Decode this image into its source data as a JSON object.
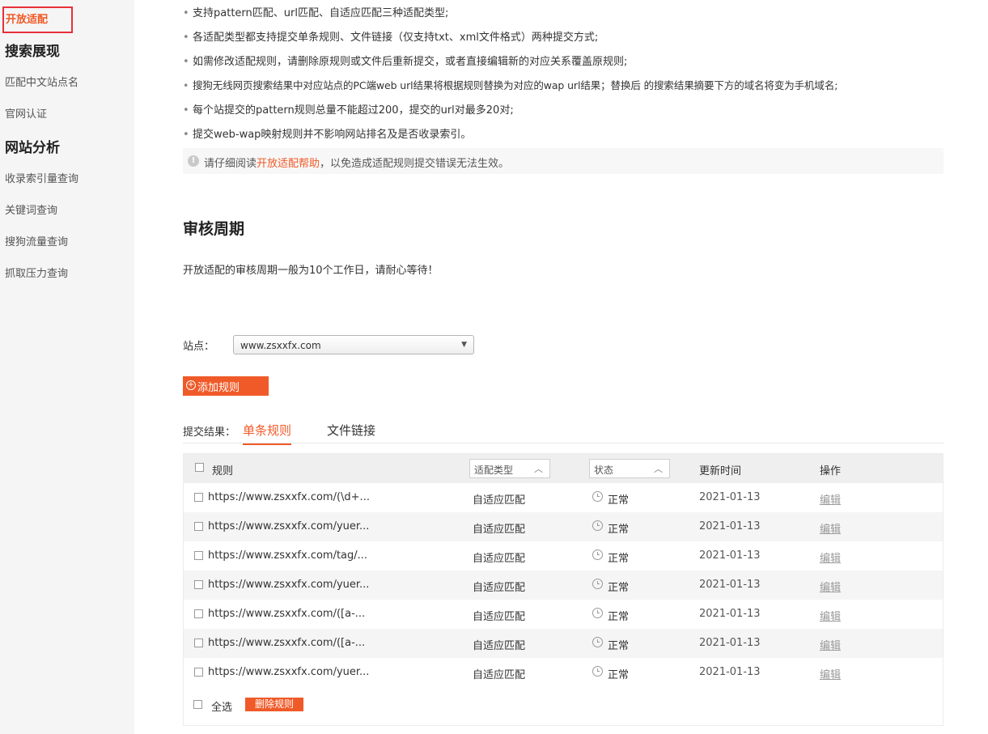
{
  "sidebar": {
    "active_item": "开放适配",
    "groups": [
      {
        "heading": "搜索展现",
        "items": [
          "匹配中文站点名",
          "官网认证"
        ]
      },
      {
        "heading": "网站分析",
        "items": [
          "收录索引量查询",
          "关键词查询",
          "搜狗流量查询",
          "抓取压力查询"
        ]
      }
    ]
  },
  "notes": {
    "bullets": [
      "支持pattern匹配、url匹配、自适应匹配三种适配类型;",
      "各适配类型都支持提交单条规则、文件链接（仅支持txt、xml文件格式）两种提交方式;",
      "如需修改适配规则，请删除原规则或文件后重新提交，或者直接编辑新的对应关系覆盖原规则;",
      "搜狗无线网页搜索结果中对应站点的PC端web url结果将根据规则替换为对应的wap url结果；替换后 的搜索结果摘要下方的域名将变为手机域名;",
      "每个站提交的pattern规则总量不能超过200，提交的url对最多20对;",
      "提交web-wap映射规则并不影响网站排名及是否收录索引。"
    ],
    "notice_prefix": "请仔细阅读",
    "notice_link": "开放适配帮助",
    "notice_suffix": "，以免造成适配规则提交错误无法生效。"
  },
  "review": {
    "title": "审核周期",
    "desc": "开放适配的审核周期一般为10个工作日，请耐心等待！"
  },
  "site": {
    "label": "站点：",
    "value": "www.zsxxfx.com"
  },
  "add_button": "添加规则",
  "tabs": {
    "label": "提交结果：",
    "items": [
      "单条规则",
      "文件链接"
    ]
  },
  "table": {
    "headers": {
      "rule": "规则",
      "type": "适配类型",
      "status": "状态",
      "updated": "更新时间",
      "action": "操作"
    },
    "rows": [
      {
        "rule": "https://www.zsxxfx.com/(\\d+...",
        "type": "自适应匹配",
        "status": "正常",
        "updated": "2021-01-13",
        "action": "编辑"
      },
      {
        "rule": "https://www.zsxxfx.com/yuer...",
        "type": "自适应匹配",
        "status": "正常",
        "updated": "2021-01-13",
        "action": "编辑"
      },
      {
        "rule": "https://www.zsxxfx.com/tag/...",
        "type": "自适应匹配",
        "status": "正常",
        "updated": "2021-01-13",
        "action": "编辑"
      },
      {
        "rule": "https://www.zsxxfx.com/yuer...",
        "type": "自适应匹配",
        "status": "正常",
        "updated": "2021-01-13",
        "action": "编辑"
      },
      {
        "rule": "https://www.zsxxfx.com/([a-...",
        "type": "自适应匹配",
        "status": "正常",
        "updated": "2021-01-13",
        "action": "编辑"
      },
      {
        "rule": "https://www.zsxxfx.com/([a-...",
        "type": "自适应匹配",
        "status": "正常",
        "updated": "2021-01-13",
        "action": "编辑"
      },
      {
        "rule": "https://www.zsxxfx.com/yuer...",
        "type": "自适应匹配",
        "status": "正常",
        "updated": "2021-01-13",
        "action": "编辑"
      }
    ],
    "select_all": "全选",
    "delete_button": "删除规则"
  },
  "colors": {
    "accent": "#f05a28",
    "highlight_box": "#e8303a"
  }
}
